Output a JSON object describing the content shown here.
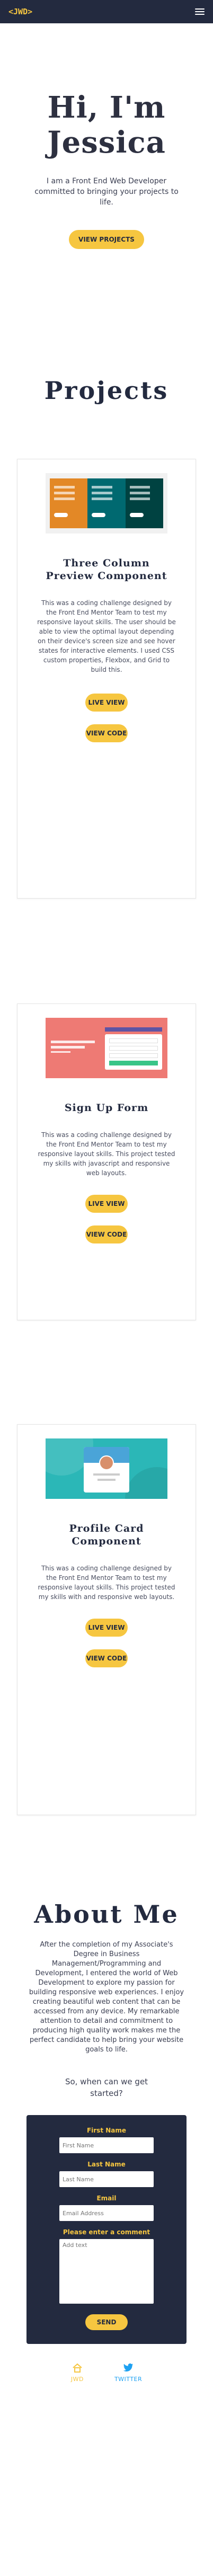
{
  "nav": {
    "logo": "<JWD>",
    "menu_icon": "hamburger-icon"
  },
  "hero": {
    "title": "Hi, I'm Jessica",
    "subtitle": "I am a Front End Web Developer committed to bringing your projects to life.",
    "button": "VIEW PROJECTS"
  },
  "projects": {
    "title": "Projects",
    "items": [
      {
        "title": "Three Column Preview Component",
        "description": "This was a coding challenge designed by the Front End Mentor Team to test my responsive layout skills. The user should be able to view the optimal layout depending on their device's screen size and see hover states for interactive elements. I used CSS custom properties, Flexbox, and Grid to build this.",
        "live_label": "LIVE VIEW",
        "code_label": "VIEW CODE",
        "thumbnail_colors": [
          "#e38826",
          "#006970",
          "#004241"
        ]
      },
      {
        "title": "Sign Up Form",
        "description": "This was a coding challenge designed by the Front End Mentor Team to test my responsive layout skills. This project tested my skills with javascript and responsive web layouts.",
        "live_label": "LIVE VIEW",
        "code_label": "VIEW CODE"
      },
      {
        "title": "Profile Card Component",
        "description": "This was a coding challenge designed by the Front End Mentor Team to test my responsive layout skills. This project tested my skills with and responsive web layouts.",
        "live_label": "LIVE VIEW",
        "code_label": "VIEW CODE"
      }
    ]
  },
  "about": {
    "title": "About Me",
    "text": "After the completion of my Associate's Degree in Business Management/Programming and Development, I entered the world of Web Development to explore my passion for building responsive web experiences. I enjoy creating beautiful web content that can be accessed from any device. My remarkable attention to detail and commitment to producing high quality work makes me the perfect candidate to help bring your website goals to life."
  },
  "cta": "So, when can we get started?",
  "form": {
    "first_label": "First Name",
    "first_placeholder": "First Name",
    "last_label": "Last Name",
    "last_placeholder": "Last Name",
    "email_label": "Email",
    "email_placeholder": "Email Address",
    "comment_label": "Please enter a comment",
    "comment_placeholder": "Add text",
    "send": "SEND"
  },
  "footer": {
    "home_label": "JWD",
    "twitter_label": "TWITTER",
    "home_icon": "home-icon",
    "twitter_icon": "twitter-icon"
  },
  "colors": {
    "navy": "#232a3f",
    "accent": "#f6c640",
    "twitter": "#1da1f2"
  }
}
